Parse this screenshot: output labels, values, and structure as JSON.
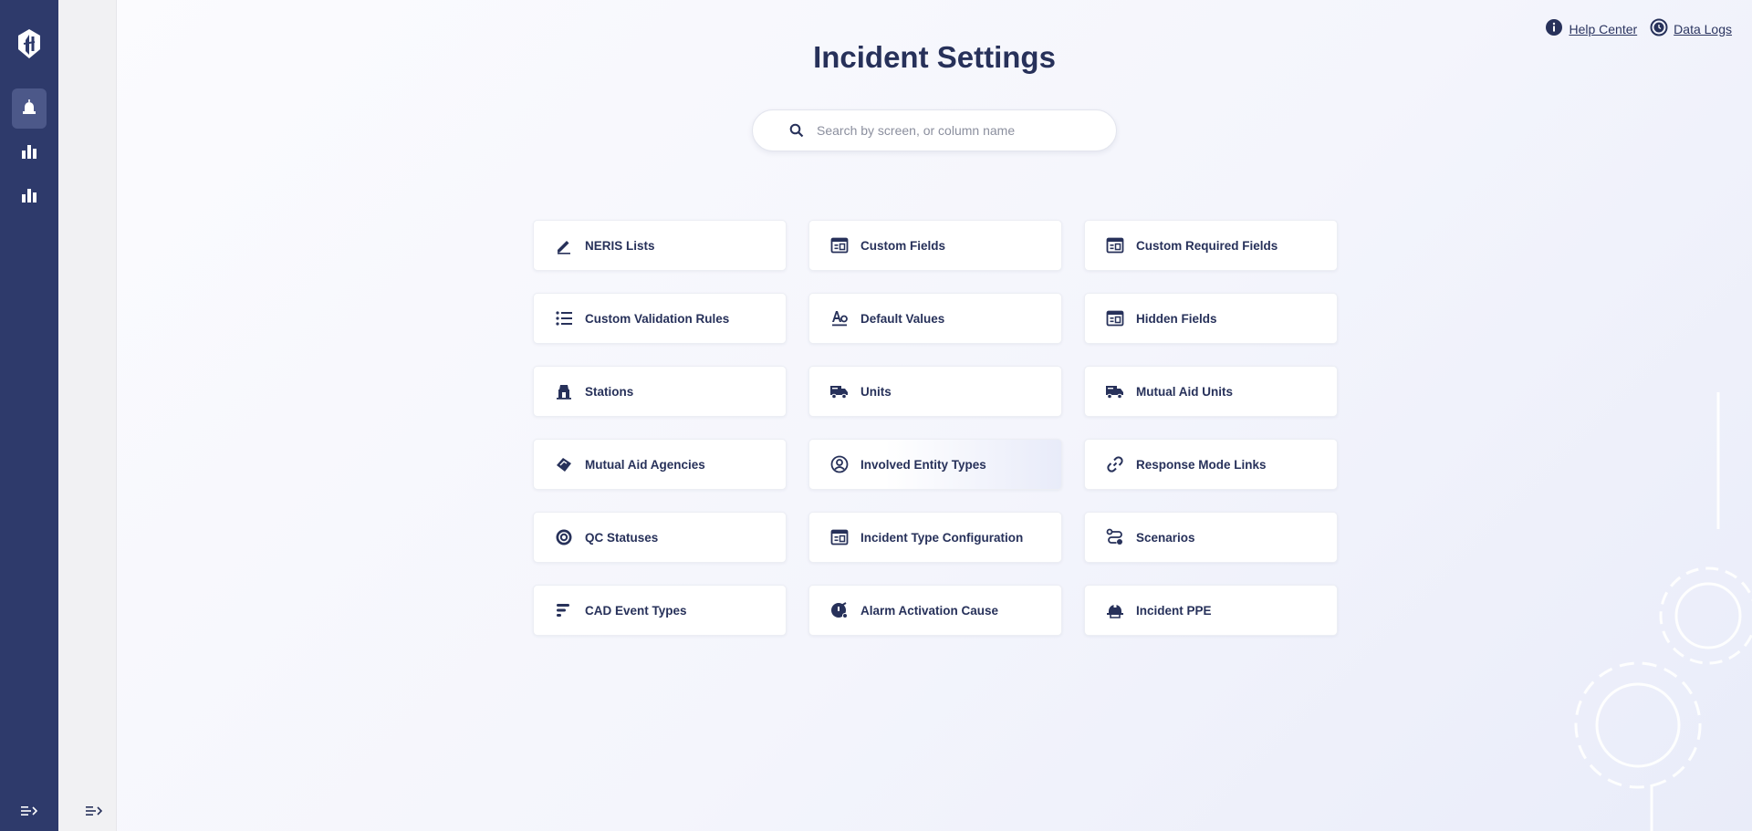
{
  "page": {
    "title": "Incident Settings"
  },
  "links": {
    "help_center": "Help Center",
    "data_logs": "Data Logs"
  },
  "search": {
    "placeholder": "Search by screen, or column name",
    "value": ""
  },
  "rail": {
    "items": [
      {
        "icon": "incident-siren-icon",
        "active": true
      },
      {
        "icon": "bar-chart-icon",
        "active": false
      },
      {
        "icon": "bar-chart-icon",
        "active": false
      }
    ]
  },
  "settings": {
    "items": [
      {
        "label": "NERIS Lists",
        "icon": "pencil-icon"
      },
      {
        "label": "Custom Fields",
        "icon": "table-form-icon"
      },
      {
        "label": "Custom Required Fields",
        "icon": "table-form-icon"
      },
      {
        "label": "Custom Validation Rules",
        "icon": "list-icon"
      },
      {
        "label": "Default Values",
        "icon": "text-format-icon"
      },
      {
        "label": "Hidden Fields",
        "icon": "table-form-icon"
      },
      {
        "label": "Stations",
        "icon": "station-building-icon"
      },
      {
        "label": "Units",
        "icon": "truck-icon"
      },
      {
        "label": "Mutual Aid Units",
        "icon": "truck-icon"
      },
      {
        "label": "Mutual Aid Agencies",
        "icon": "handshake-icon"
      },
      {
        "label": "Involved Entity Types",
        "icon": "person-circle-icon"
      },
      {
        "label": "Response Mode Links",
        "icon": "link-icon"
      },
      {
        "label": "QC Statuses",
        "icon": "badge-check-icon"
      },
      {
        "label": "Incident Type Configuration",
        "icon": "table-form-icon"
      },
      {
        "label": "Scenarios",
        "icon": "route-icon"
      },
      {
        "label": "CAD Event Types",
        "icon": "bars-icon"
      },
      {
        "label": "Alarm Activation Cause",
        "icon": "alarm-bell-icon"
      },
      {
        "label": "Incident PPE",
        "icon": "firefighter-helmet-icon"
      }
    ]
  },
  "colors": {
    "rail": "#2e3a6b",
    "accent": "#27315a"
  }
}
